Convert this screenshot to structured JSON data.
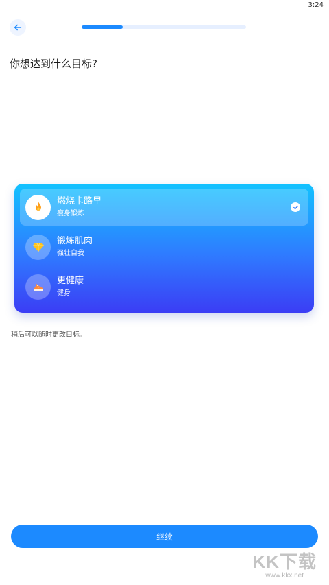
{
  "status_bar": {
    "time": "3:24"
  },
  "progress": {
    "fraction": 0.25
  },
  "page": {
    "title": "你想达到什么目标?"
  },
  "goals": [
    {
      "label": "燃烧卡路里",
      "sub": "瘦身锻炼",
      "icon": "flame-icon",
      "selected": true
    },
    {
      "label": "锻炼肌肉",
      "sub": "强壮自我",
      "icon": "diamond-icon",
      "selected": false
    },
    {
      "label": "更健康",
      "sub": "健身",
      "icon": "sneaker-icon",
      "selected": false
    }
  ],
  "hint": "稍后可以随时更改目标。",
  "continue_label": "继续",
  "watermark": {
    "logo": "KK下载",
    "url": "www.kkx.net"
  },
  "colors": {
    "accent": "#1c8aff",
    "card_top": "#12c2ff",
    "card_bottom": "#3b3df5"
  }
}
